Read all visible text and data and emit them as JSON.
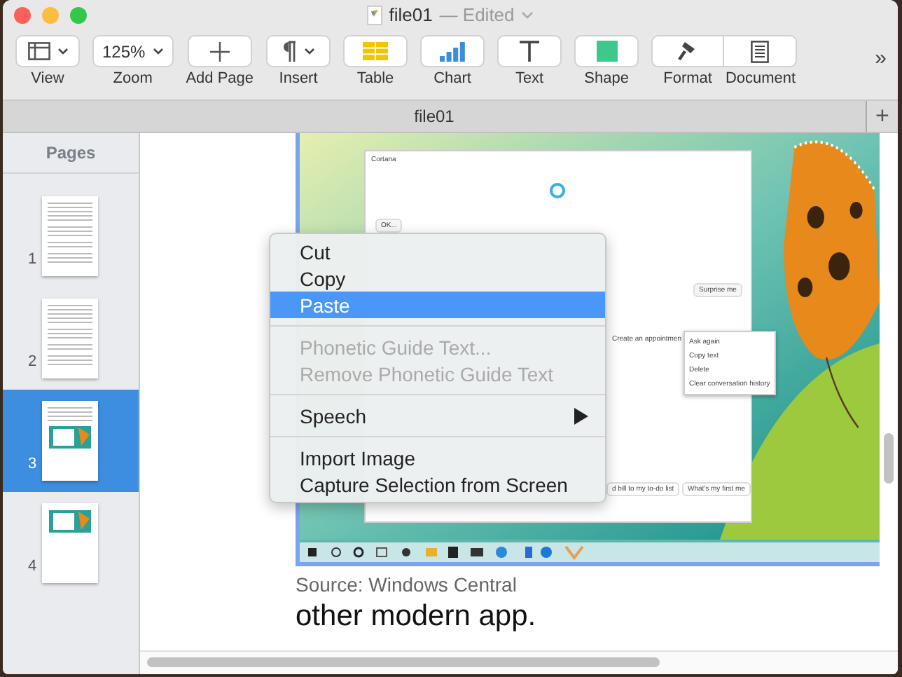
{
  "window": {
    "title": "file01",
    "status": "— Edited"
  },
  "toolbar": {
    "items": [
      {
        "kind": "view",
        "label": "View"
      },
      {
        "kind": "zoom",
        "label": "Zoom",
        "value": "125%"
      },
      {
        "kind": "add",
        "label": "Add Page"
      },
      {
        "kind": "insert",
        "label": "Insert"
      },
      {
        "kind": "table",
        "label": "Table"
      },
      {
        "kind": "chart",
        "label": "Chart"
      },
      {
        "kind": "text",
        "label": "Text"
      },
      {
        "kind": "shape",
        "label": "Shape"
      },
      {
        "kind": "format",
        "label": "Format"
      },
      {
        "kind": "document",
        "label": "Document"
      }
    ],
    "overflow": "»"
  },
  "tab_bar": {
    "tab": "file01",
    "new_tab": "+"
  },
  "sidebar": {
    "header": "Pages",
    "pages": [
      {
        "number": "1",
        "kind": "text",
        "selected": false
      },
      {
        "number": "2",
        "kind": "text",
        "selected": false
      },
      {
        "number": "3",
        "kind": "text-image",
        "selected": true
      },
      {
        "number": "4",
        "kind": "image",
        "selected": false
      }
    ]
  },
  "document": {
    "image": {
      "window_title": "Cortana",
      "messages": [
        "OK...",
        "Surprise me",
        "Create an appointmen"
      ],
      "popup_menu": [
        "Ask again",
        "Copy text",
        "Delete",
        "Clear conversation history"
      ],
      "suggestions": [
        "d bill to my to-do list",
        "What's my first me"
      ]
    },
    "caption": "Source: Windows Central",
    "body": "other modern app."
  },
  "context_menu": {
    "groups": [
      [
        {
          "label": "Cut",
          "disabled": false,
          "selected": false,
          "submenu": false
        },
        {
          "label": "Copy",
          "disabled": false,
          "selected": false,
          "submenu": false
        },
        {
          "label": "Paste",
          "disabled": false,
          "selected": true,
          "submenu": false
        }
      ],
      [
        {
          "label": "Phonetic Guide Text...",
          "disabled": true,
          "selected": false,
          "submenu": false
        },
        {
          "label": "Remove Phonetic Guide Text",
          "disabled": true,
          "selected": false,
          "submenu": false
        }
      ],
      [
        {
          "label": "Speech",
          "disabled": false,
          "selected": false,
          "submenu": true
        }
      ],
      [
        {
          "label": "Import Image",
          "disabled": false,
          "selected": false,
          "submenu": false
        },
        {
          "label": "Capture Selection from Screen",
          "disabled": false,
          "selected": false,
          "submenu": false
        }
      ]
    ]
  }
}
